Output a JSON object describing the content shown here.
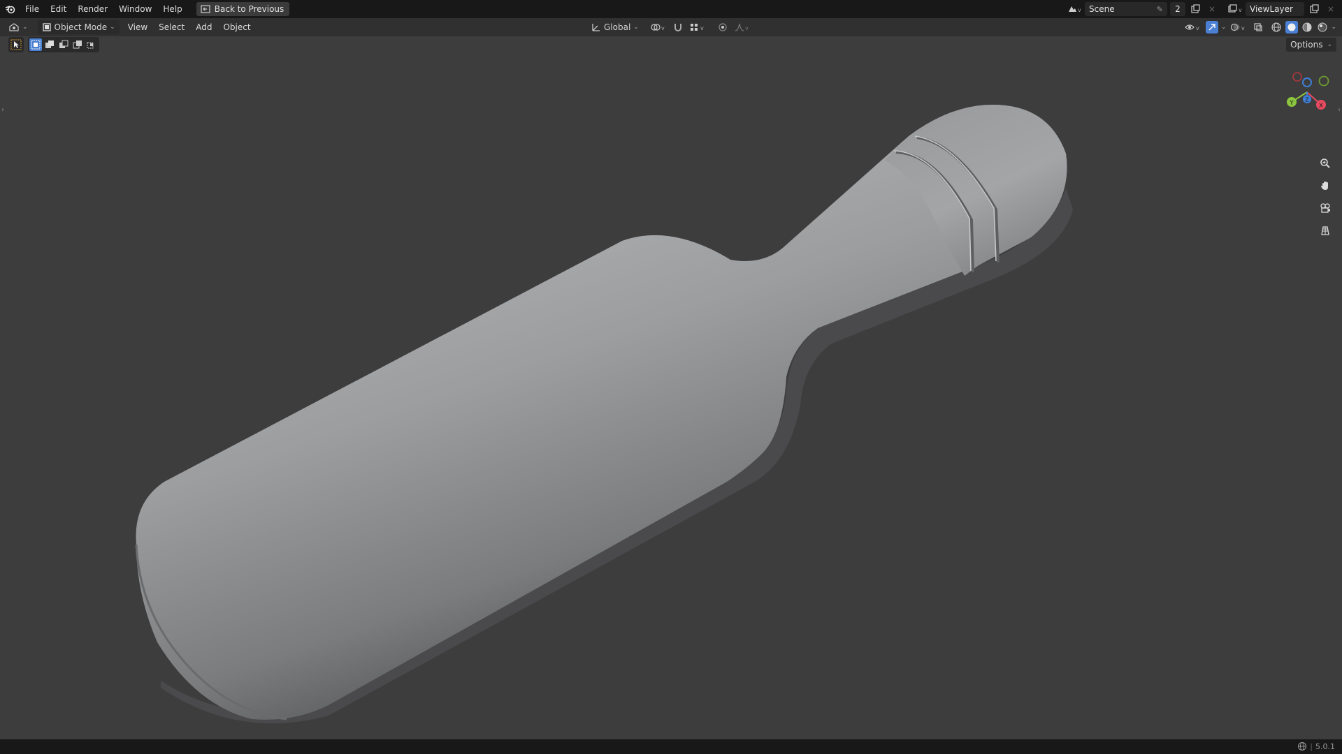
{
  "topbar": {
    "menu": [
      "File",
      "Edit",
      "Render",
      "Window",
      "Help"
    ],
    "back_label": "Back to Previous",
    "scene_name": "Scene",
    "users_count": "2",
    "view_layer": "ViewLayer"
  },
  "header": {
    "mode_label": "Object Mode",
    "menu": [
      "View",
      "Select",
      "Add",
      "Object"
    ],
    "transform_orientation": "Global",
    "options_label": "Options"
  },
  "status": {
    "version": "5.0.1"
  },
  "colors": {
    "viewport_bg": "#3d3d3d",
    "topbar_bg": "#181818",
    "header_bg": "#303030",
    "accent_blue": "#4a7fd1",
    "gizmo_x": "#e84a5f",
    "gizmo_y": "#8cc63f",
    "gizmo_z": "#3f7fd6"
  },
  "icons": {
    "app": "blender-logo-icon",
    "back": "back-to-previous-icon",
    "zoom": "zoom-icon",
    "pan": "hand-icon",
    "camera": "camera-icon",
    "perspective": "grid-icon"
  },
  "gizmo_labels": {
    "x": "X",
    "y": "Y",
    "z": "Z"
  }
}
